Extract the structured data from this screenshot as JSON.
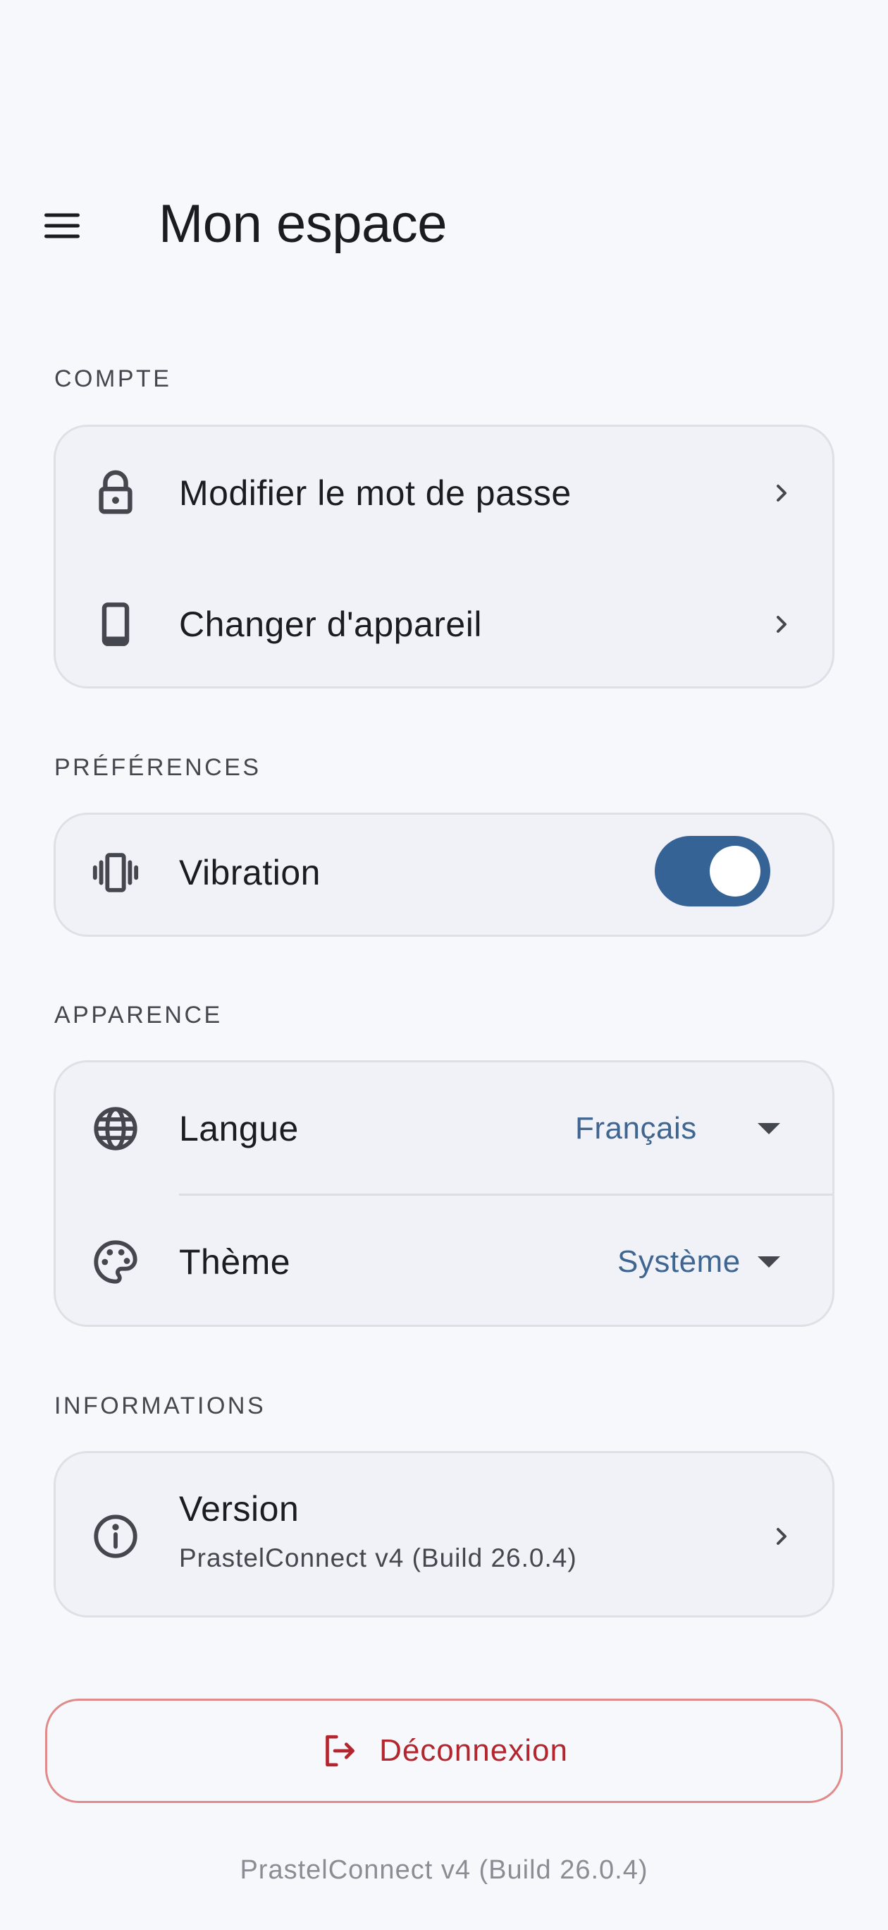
{
  "header": {
    "title": "Mon espace"
  },
  "sections": {
    "compte": {
      "title": "COMPTE",
      "items": [
        {
          "label": "Modifier le mot de passe",
          "icon": "lock-icon"
        },
        {
          "label": "Changer d'appareil",
          "icon": "phone-icon"
        }
      ]
    },
    "preferences": {
      "title": "PRÉFÉRENCES",
      "vibration": {
        "label": "Vibration",
        "icon": "vibration-icon",
        "enabled": true
      }
    },
    "apparence": {
      "title": "APPARENCE",
      "langue": {
        "label": "Langue",
        "value": "Français",
        "icon": "globe-icon"
      },
      "theme": {
        "label": "Thème",
        "value": "Système",
        "icon": "palette-icon"
      }
    },
    "informations": {
      "title": "INFORMATIONS",
      "version": {
        "label": "Version",
        "value": "PrastelConnect v4 (Build 26.0.4)",
        "icon": "info-icon"
      }
    }
  },
  "logout": {
    "label": "Déconnexion"
  },
  "footer": {
    "text": "PrastelConnect v4 (Build 26.0.4)"
  },
  "colors": {
    "accent": "#356396",
    "danger": "#b3262e",
    "background": "#f7f8fc",
    "card": "#f1f2f8"
  }
}
